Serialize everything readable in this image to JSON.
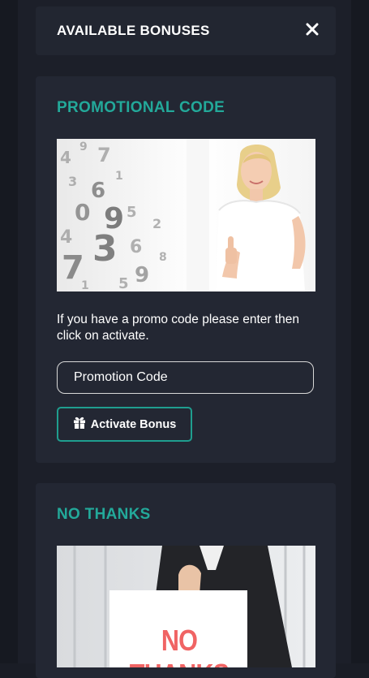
{
  "header": {
    "title": "AVAILABLE BONUSES",
    "close_icon": "close-icon"
  },
  "promo_card": {
    "title": "PROMOTIONAL CODE",
    "image_icon": "promo-woman-thumbs-up-image",
    "description": "If you have a promo code please enter then click on activate.",
    "input_placeholder": "Promotion Code",
    "activate_label": "Activate Bonus",
    "activate_icon": "gift-icon"
  },
  "no_thanks_card": {
    "title": "NO THANKS",
    "image_sign_text": "NO THANKS"
  },
  "colors": {
    "accent": "#23a99a",
    "background": "#1a1d26",
    "card": "#232733",
    "sign_text": "#f06464"
  }
}
